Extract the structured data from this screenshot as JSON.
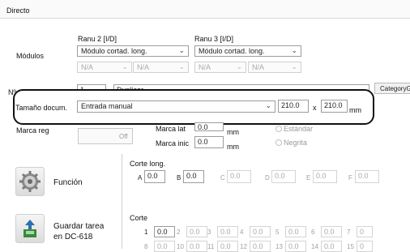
{
  "window": {
    "title": "Directo"
  },
  "modules": {
    "label": "Módulos",
    "col1": {
      "header": "Ranu 2 [I/D]",
      "module": "Módulo cortad. long.",
      "na1": "N/A",
      "na2": "N/A"
    },
    "col2": {
      "header": "Ranu 3 [I/D]",
      "module": "Módulo cortad. long.",
      "na1": "N/A",
      "na2": "N/A"
    }
  },
  "task": {
    "label": "Nº tarea",
    "number": "1",
    "name": "Duplicar",
    "category_button": "CategoryG"
  },
  "doc_size": {
    "label": "Tamaño docum.",
    "value": "Entrada manual",
    "width": "210.0",
    "times": "x",
    "height": "210.0",
    "unit": "mm"
  },
  "registration": {
    "label": "Marca reg",
    "toggle": "Off",
    "mark_lat_label": "Marca lat",
    "mark_lat_value": "0.0",
    "mark_lat_unit": "mm",
    "mark_start_label": "Marca inic",
    "mark_start_value": "0.0",
    "mark_start_unit": "mm",
    "radio_standard": "Estándar",
    "radio_bold": "Negrita"
  },
  "function": {
    "label": "Función",
    "icon": "gear-icon"
  },
  "long_cut": {
    "title": "Corte long.",
    "fields": [
      {
        "key": "A",
        "value": "0.0"
      },
      {
        "key": "B",
        "value": "0.0"
      },
      {
        "key": "C",
        "value": "0.0"
      },
      {
        "key": "D",
        "value": "0.0"
      },
      {
        "key": "E",
        "value": "0.0"
      },
      {
        "key": "F",
        "value": "0.0"
      }
    ]
  },
  "save": {
    "label_line1": "Guardar tarea",
    "label_line2": "en DC-618",
    "icon": "save-icon"
  },
  "cut": {
    "title": "Corte",
    "row1": [
      {
        "key": "1",
        "value": "0.0"
      },
      {
        "key": "2",
        "value": "0.0"
      },
      {
        "key": "3",
        "value": "0.0"
      },
      {
        "key": "4",
        "value": "0.0"
      },
      {
        "key": "5",
        "value": "0.0"
      },
      {
        "key": "6",
        "value": "0.0"
      },
      {
        "key": "7",
        "value": "0"
      }
    ],
    "row2": [
      {
        "key": "8",
        "value": "0.0"
      },
      {
        "key": "10",
        "value": "0.0"
      },
      {
        "key": "11",
        "value": "0.0"
      },
      {
        "key": "12",
        "value": "0.0"
      },
      {
        "key": "13",
        "value": "0.0"
      },
      {
        "key": "14",
        "value": "0.0"
      },
      {
        "key": "15",
        "value": "0"
      }
    ]
  }
}
